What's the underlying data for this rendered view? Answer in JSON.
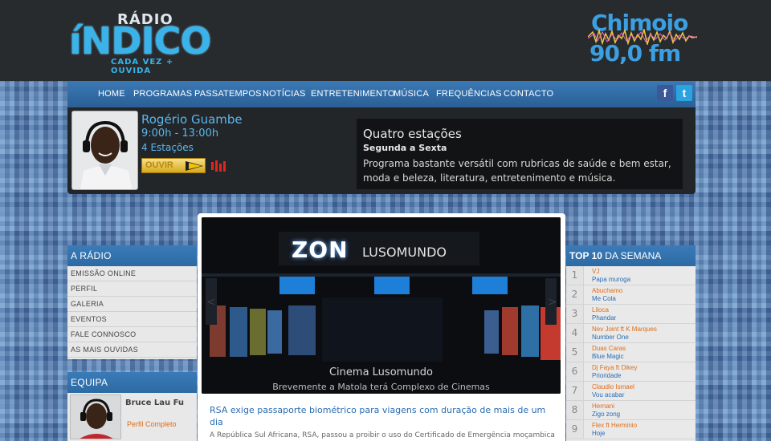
{
  "header": {
    "logo_radio": "RÁDIO",
    "logo_indico": "íNDICO",
    "logo_tagline": "CADA VEZ + OUVIDA",
    "chimoio_line1": "Chimoio",
    "chimoio_line2": "90,0 fm"
  },
  "nav": {
    "items": [
      "HOME",
      "PROGRAMAS",
      "PASSATEMPOS",
      "NOTÍCIAS",
      "ENTRETENIMENTO",
      "MÚSICA",
      "FREQUÊNCIAS",
      "CONTACTO"
    ],
    "facebook": "f",
    "twitter": "t"
  },
  "now_playing": {
    "host_name": "Rogério Guambe",
    "time": "9:00h - 13:00h",
    "show": "4 Estações",
    "listen_label": "OUVIR",
    "program_title": "Quatro estações",
    "program_days": "Segunda a Sexta",
    "program_desc": "Programa bastante versátil com rubricas de saúde e bem estar, moda e beleza, literatura, entretenimento e música."
  },
  "sidebar": {
    "radio_title": "A RÁDIO",
    "radio_items": [
      "EMISSÃO ONLINE",
      "PERFIL",
      "GALERIA",
      "EVENTOS",
      "FALE CONNOSCO",
      "AS MAIS OUVIDAS"
    ],
    "equipa_title": "EQUIPA",
    "equipa_name": "Bruce Lau Fu",
    "equipa_link": "Perfil Completo"
  },
  "main": {
    "slide_sign_1": "ZON",
    "slide_sign_2": "LUSOMUNDO",
    "slide_caption": "Cinema Lusomundo",
    "slide_subcaption": "Brevemente a Matola terá Complexo de Cinemas",
    "news_title": "RSA exige passaporte biométrico para viagens com duração de mais de um dia",
    "news_body": "A República Sul Africana, RSA, passou a proibir o uso do Certificado de Emergência moçambicano,"
  },
  "top10": {
    "title_bold": "TOP 10",
    "title_rest": " DA SEMANA",
    "rows": [
      {
        "num": "1",
        "artist": "VJ",
        "song": "Papa muroga"
      },
      {
        "num": "2",
        "artist": "Abuchamo",
        "song": "Me Cola"
      },
      {
        "num": "3",
        "artist": "Liloca",
        "song": "Phandar"
      },
      {
        "num": "4",
        "artist": "Nev Joint ft K Marques",
        "song": "Number One"
      },
      {
        "num": "5",
        "artist": "Duas Caras",
        "song": "Blue Magic"
      },
      {
        "num": "6",
        "artist": "Dj Faya ft Dikey",
        "song": "Prioridade"
      },
      {
        "num": "7",
        "artist": "Claudio Ismael",
        "song": "Vou acabar"
      },
      {
        "num": "8",
        "artist": "Hernani",
        "song": "Zigo zong"
      },
      {
        "num": "9",
        "artist": "Flex ft Herminio",
        "song": "Hoje"
      }
    ]
  }
}
